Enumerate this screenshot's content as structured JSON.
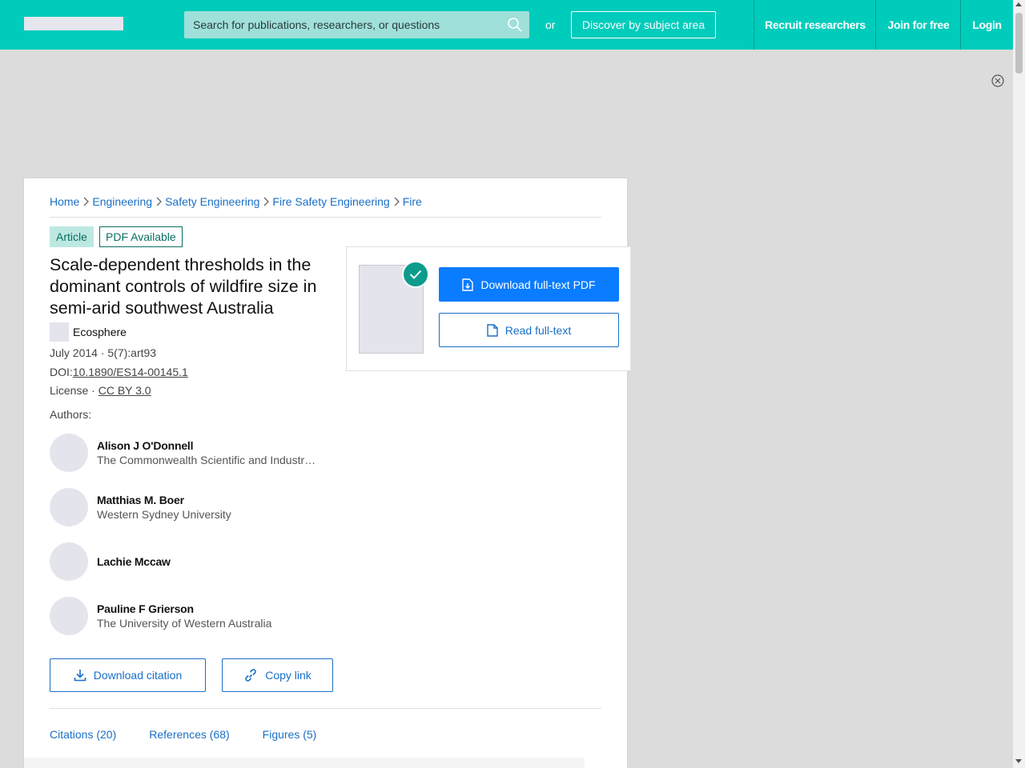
{
  "header": {
    "search_placeholder": "Search for publications, researchers, or questions",
    "or_text": "or",
    "discover_label": "Discover by subject area",
    "nav": [
      "Recruit researchers",
      "Join for free",
      "Login"
    ]
  },
  "breadcrumb": [
    "Home",
    "Engineering",
    "Safety Engineering",
    "Fire Safety Engineering",
    "Fire"
  ],
  "tags": {
    "type": "Article",
    "pdf": "PDF Available"
  },
  "publication": {
    "title": "Scale-dependent thresholds in the dominant controls of wildfire size in semi-arid southwest Australia",
    "journal": "Ecosphere",
    "date_info": "July 2014 · 5(7):art93",
    "doi_label": "DOI:",
    "doi": "10.1890/ES14-00145.1",
    "license_label": "License · ",
    "license": "CC BY 3.0",
    "authors_label": "Authors:"
  },
  "authors": [
    {
      "name": "Alison J O'Donnell",
      "affiliation": "The Commonwealth Scientific and Industrial Research Organisation"
    },
    {
      "name": "Matthias M. Boer",
      "affiliation": "Western Sydney University"
    },
    {
      "name": "Lachie Mccaw",
      "affiliation": ""
    },
    {
      "name": "Pauline F Grierson",
      "affiliation": "The University of Western Australia"
    }
  ],
  "actions": {
    "download_citation": "Download citation",
    "copy_link": "Copy link"
  },
  "tabs": [
    "Citations (20)",
    "References (68)",
    "Figures (5)"
  ],
  "pdf_panel": {
    "download_label": "Download full-text PDF",
    "read_label": "Read full-text"
  },
  "colors": {
    "brand": "#00ccbb",
    "link": "#1a6fc6",
    "primary_button": "#0a7cff",
    "check": "#0d9c8c"
  }
}
